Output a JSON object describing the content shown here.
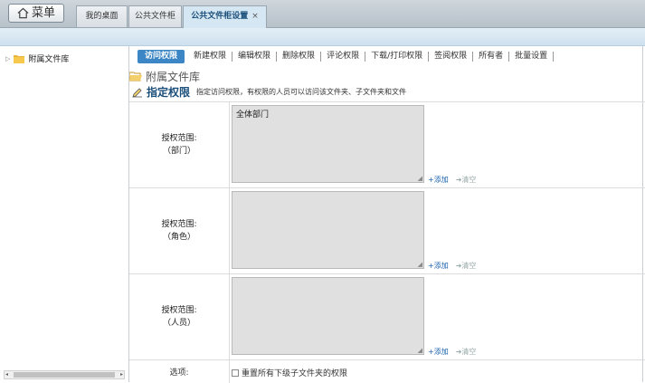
{
  "header": {
    "menu_label": "菜单",
    "tabs": [
      {
        "label": "我的桌面",
        "active": false
      },
      {
        "label": "公共文件柜",
        "active": false
      },
      {
        "label": "公共文件柜设置",
        "active": true,
        "close": "×"
      }
    ]
  },
  "sidebar": {
    "tree": [
      {
        "label": "附属文件库",
        "arrow": "▷"
      }
    ]
  },
  "perm_tabs": [
    "访问权限",
    "新建权限",
    "编辑权限",
    "删除权限",
    "评论权限",
    "下载/打印权限",
    "签阅权限",
    "所有者",
    "批量设置"
  ],
  "content": {
    "folder_name": "附属文件库",
    "section_title": "指定权限",
    "section_desc": "指定访问权限，有权限的人员可以访问该文件夹、子文件夹和文件",
    "rows": [
      {
        "label1": "授权范围:",
        "label2": "（部门）",
        "value": "全体部门",
        "add": "+添加",
        "clear": "清空"
      },
      {
        "label1": "授权范围:",
        "label2": "（角色）",
        "value": "",
        "add": "+添加",
        "clear": "清空"
      },
      {
        "label1": "授权范围:",
        "label2": "（人员）",
        "value": "",
        "add": "+添加",
        "clear": "清空"
      }
    ],
    "options_label": "选项:",
    "options_checkbox": "重置所有下级子文件夹的权限"
  }
}
